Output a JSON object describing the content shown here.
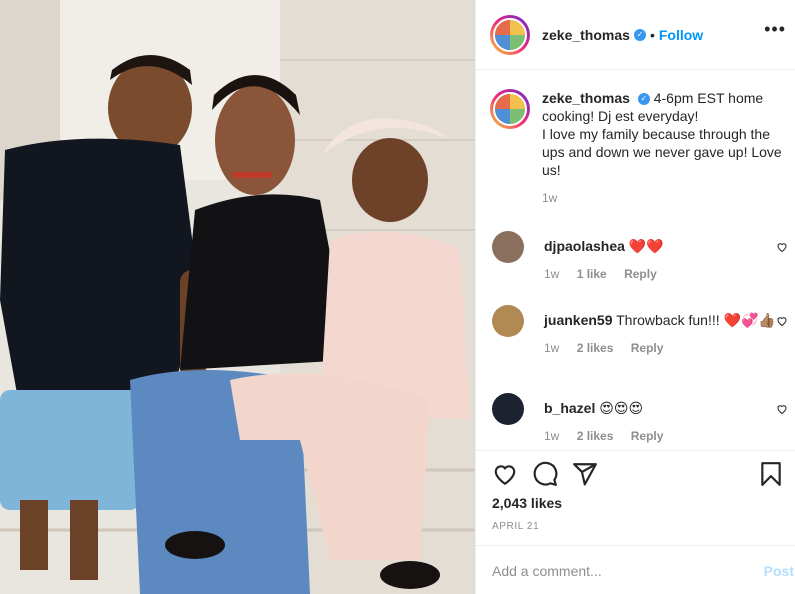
{
  "post": {
    "username": "zeke_thomas",
    "follow_label": "Follow",
    "more_label": "•••"
  },
  "caption": {
    "username": "zeke_thomas",
    "text": "4-6pm EST home cooking! Dj est everyday!\nI love my family because through the ups and down we never gave up! Love us!",
    "time": "1w"
  },
  "comments": [
    {
      "username": "djpaolashea",
      "text": "",
      "emoji": "❤️❤️",
      "time": "1w",
      "likes": "1 like",
      "reply": "Reply"
    },
    {
      "username": "juanken59",
      "text": "Throwback fun!!!",
      "emoji": "❤️💞👍🏽",
      "time": "1w",
      "likes": "2 likes",
      "reply": "Reply"
    },
    {
      "username": "b_hazel",
      "text": "",
      "emoji": "😍😍😍",
      "time": "1w",
      "likes": "2 likes",
      "reply": "Reply"
    }
  ],
  "stats": {
    "likes": "2,043 likes",
    "date": "APRIL 21"
  },
  "composer": {
    "placeholder": "Add a comment...",
    "post_label": "Post"
  },
  "colors": {
    "accent": "#0095f6",
    "post_disabled": "#b2dffc",
    "muted": "#8e8e8e",
    "heart": "#ed4956"
  },
  "icons": [
    "more-options-icon",
    "verified-badge-icon",
    "like-icon",
    "comment-icon",
    "share-icon",
    "save-icon",
    "comment-like-icon"
  ]
}
